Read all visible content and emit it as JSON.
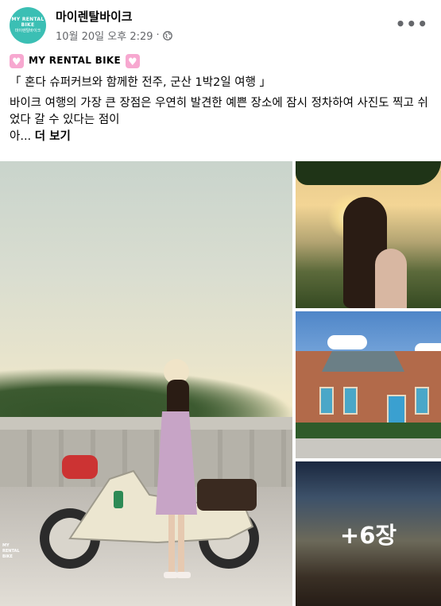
{
  "post": {
    "page_name": "마이렌탈바이크",
    "timestamp": "10월 20일 오후 2:29",
    "separator": "·",
    "privacy_icon": "globe-icon",
    "more_options_icon": "•••"
  },
  "avatar": {
    "line1": "MY RENTAL BIKE",
    "line2": "마이렌탈바이크",
    "color": "#3bbfb4"
  },
  "content": {
    "tag": "MY RENTAL BIKE",
    "title": "「 혼다 슈퍼커브와 함께한 전주, 군산 1박2일 여행 」",
    "description": "바이크 여행의 가장 큰 장점은 우연히 발견한 예쁜 장소에 잠시 정차하여 사진도 찍고 쉬었다 갈 수 있다는 점이\n아...",
    "see_more": "더 보기"
  },
  "photos": {
    "main_logo": "MY\nRENTAL\nBIKE",
    "more_count": "+6장"
  }
}
